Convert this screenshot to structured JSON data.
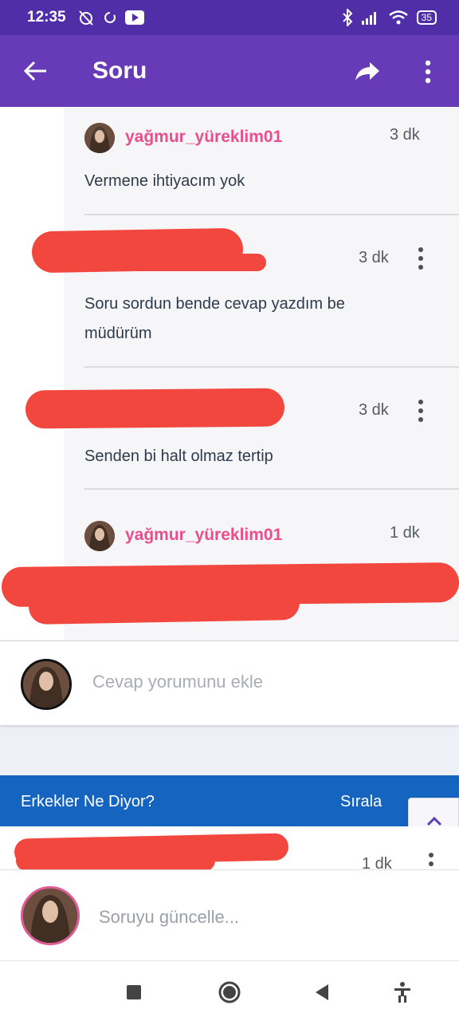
{
  "status_bar": {
    "time": "12:35",
    "battery": "35",
    "left_icons": [
      "alarm-off-icon",
      "sync-icon",
      "youtube-icon"
    ],
    "right_icons": [
      "bluetooth-icon",
      "signal-icon",
      "wifi-icon",
      "battery-icon"
    ]
  },
  "app_bar": {
    "title": "Soru",
    "background": "#673ab7",
    "icons": [
      "back-arrow-icon",
      "share-icon",
      "more-vertical-icon"
    ]
  },
  "thread": {
    "replies": [
      {
        "username": "yağmur_yüreklim01",
        "time": "3 dk",
        "text": "Vermene ihtiyacım yok"
      },
      {
        "username": "",
        "time": "3 dk",
        "text_line1": "Soru sordun bende cevap yazdım be",
        "text_line2": "müdürüm"
      },
      {
        "username": "",
        "time": "3 dk",
        "text": "Senden bi halt olmaz tertip"
      },
      {
        "username": "yağmur_yüreklim01",
        "time": "1 dk",
        "text": ""
      }
    ],
    "username_color": "#e84f8c"
  },
  "comment_box": {
    "placeholder": "Cevap yorumunu ekle"
  },
  "section": {
    "title": "Erkekler Ne Diyor?",
    "sort_label": "Sırala",
    "color": "#1565c0",
    "next_time": "1 dk"
  },
  "update_box": {
    "placeholder": "Soruyu güncelle..."
  },
  "nav_bar": {
    "icons": [
      "recents-square-icon",
      "home-circle-icon",
      "back-triangle-icon",
      "accessibility-icon"
    ]
  }
}
